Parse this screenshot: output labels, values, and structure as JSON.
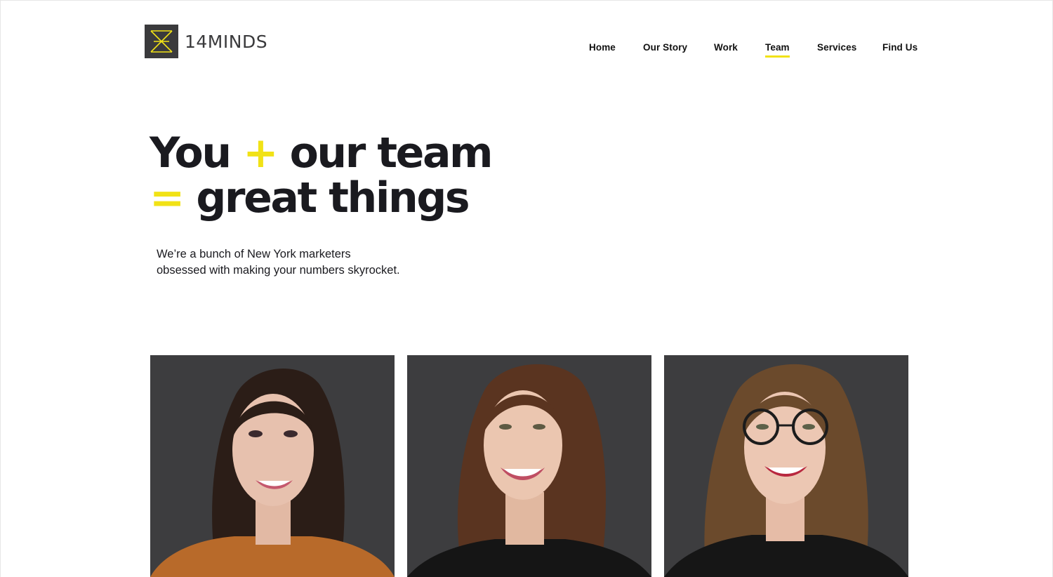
{
  "brand": {
    "name": "14MINDS",
    "logo_icon": "hourglass-mark-icon",
    "accent_color": "#f1e216",
    "dark_color": "#3a3a3c"
  },
  "nav": {
    "items": [
      {
        "label": "Home",
        "active": false
      },
      {
        "label": "Our Story",
        "active": false
      },
      {
        "label": "Work",
        "active": false
      },
      {
        "label": "Team",
        "active": true
      },
      {
        "label": "Services",
        "active": false
      },
      {
        "label": "Find Us",
        "active": false
      }
    ]
  },
  "hero": {
    "line1_word1": "You",
    "line1_op": "+",
    "line1_rest": "our team",
    "line2_op": "=",
    "line2_rest": "great things",
    "subtitle_line1": "We’re a bunch of New York marketers",
    "subtitle_line2": "obsessed with making your numbers skyrocket."
  },
  "team": {
    "members": [
      {
        "photo_icon": "team-member-portrait",
        "hair_color": "#2b1d17",
        "top_color": "#b86a2a"
      },
      {
        "photo_icon": "team-member-portrait",
        "hair_color": "#5a3420",
        "top_color": "#151515"
      },
      {
        "photo_icon": "team-member-portrait",
        "hair_color": "#6b4a2c",
        "top_color": "#161616",
        "glasses": true
      }
    ]
  }
}
